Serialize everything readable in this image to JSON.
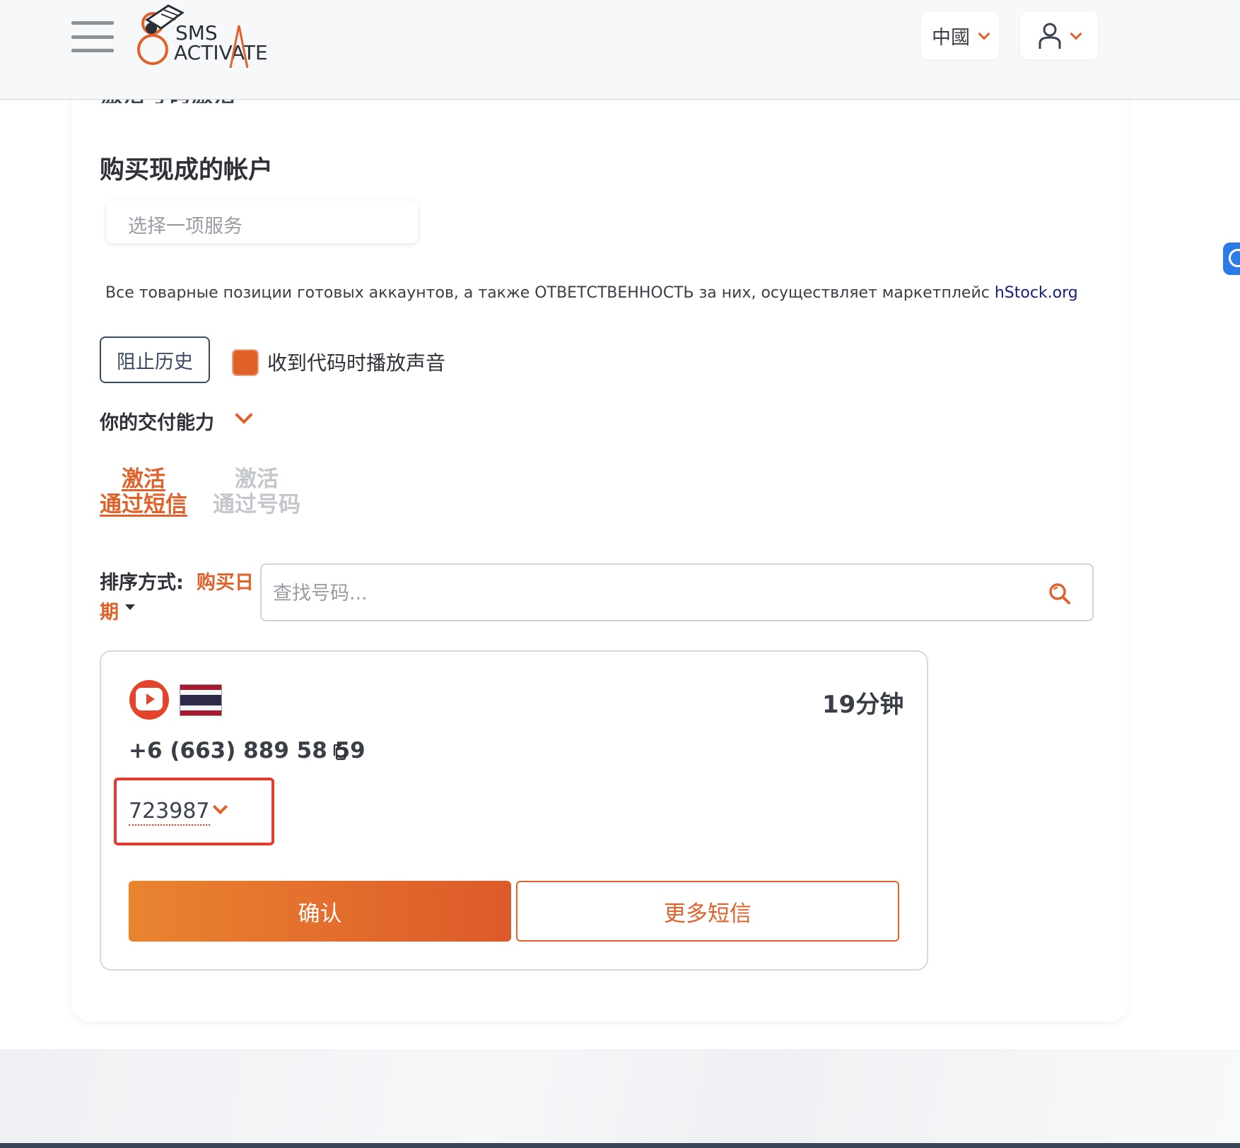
{
  "header": {
    "logo_top": "SMS",
    "logo_bottom": "ACTIVATE",
    "language": "中國"
  },
  "section": {
    "title": "购买现成的帐户",
    "service_placeholder": "选择一项服务",
    "notice_text": "Все товарные позиции готовых аккаунтов, а также ОТВЕТСТВЕННОСТЬ за них, осуществляет маркетплейс ",
    "notice_link": "hStock.org"
  },
  "controls": {
    "block_history": "阻止历史",
    "sound_label": "收到代码时播放声音",
    "sound_checked": true,
    "ability_label": "你的交付能力"
  },
  "tabs": [
    {
      "line1": "激活",
      "line2": "通过短信",
      "active": true
    },
    {
      "line1": "激活",
      "line2": "通过号码",
      "active": false
    }
  ],
  "sort": {
    "label": "排序方式:",
    "value_part1": "购买日",
    "value_part2": "期",
    "search_placeholder": "查找号码..."
  },
  "activation": {
    "service_icon": "youtube-icon",
    "country_flag": "thailand-flag-icon",
    "timer": "19分钟",
    "phone": "+6 (663) 889 58 59",
    "code": "723987",
    "confirm_label": "确认",
    "more_sms_label": "更多短信"
  },
  "colors": {
    "accent": "#e0622a",
    "highlight_border": "#e23b2f",
    "link": "#16207a"
  }
}
